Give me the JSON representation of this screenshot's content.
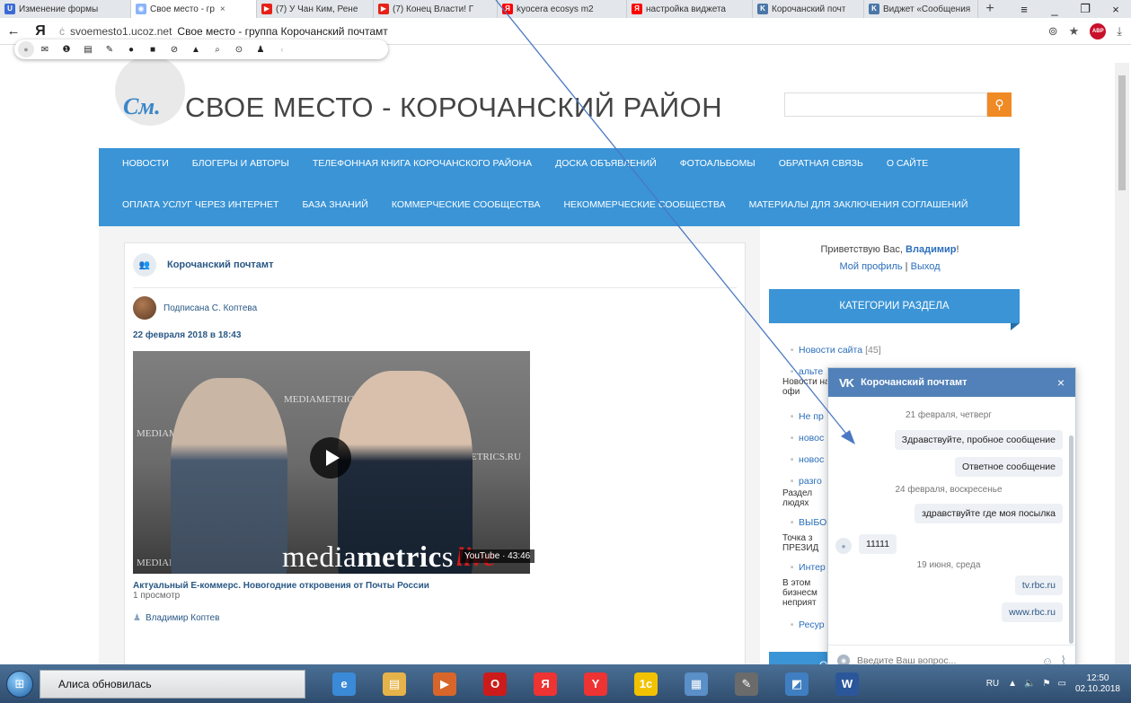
{
  "browser": {
    "tabs": [
      {
        "label": "Изменение формы",
        "icon": "ucoz-icon",
        "color": "#3b6cd6",
        "glyph": "U",
        "active": false
      },
      {
        "label": "Свое место - гр",
        "icon": "site-icon",
        "color": "#8ab4f8",
        "glyph": "◉",
        "active": true
      },
      {
        "label": "(7) У Чан Ким, Рене",
        "icon": "youtube-icon",
        "color": "#e62117",
        "glyph": "▶",
        "active": false
      },
      {
        "label": "(7) Конец Власти! Г",
        "icon": "youtube-icon",
        "color": "#e62117",
        "glyph": "▶",
        "active": false
      },
      {
        "label": "kyocera ecosys m2",
        "icon": "yandex-icon",
        "color": "#ff0000",
        "glyph": "Я",
        "active": false
      },
      {
        "label": "настройка виджета",
        "icon": "yandex-icon",
        "color": "#ff0000",
        "glyph": "Я",
        "active": false
      },
      {
        "label": "Корочанский почт",
        "icon": "vk-icon",
        "color": "#4a76a8",
        "glyph": "K",
        "active": false
      },
      {
        "label": "Виджет «Сообщения",
        "icon": "vk-icon",
        "color": "#4a76a8",
        "glyph": "K",
        "active": false
      }
    ],
    "active_tab_close": "×",
    "new_tab": "+",
    "window": {
      "menu": "≡",
      "minimize": "_",
      "restore": "❐",
      "close": "×"
    },
    "back": "←",
    "yandex_logo": "Я",
    "url_icon": "ċ",
    "url_domain": "svoemesto1.ucoz.net",
    "url_title": "Свое место - группа Корочанский почтамт",
    "ext_icon": "⊚",
    "bookmark": "★",
    "adblock": "ABP",
    "download": "⤓"
  },
  "floatbar": {
    "glyphs": [
      "✉",
      "❶",
      "▤",
      "✎",
      "●",
      "■",
      "⊘",
      "▲",
      "⌕",
      "⊙",
      "♟"
    ],
    "chevron": "‹"
  },
  "site": {
    "logo": "См.",
    "title": "СВОЕ МЕСТО - КОРОЧАНСКИЙ РАЙОН",
    "search_icon": "⚲",
    "nav_row1": [
      "Новости",
      "Блогеры и авторы",
      "Телефонная книга Корочанского района",
      "Доска объявлений",
      "Фотоальбомы",
      "Обратная связь",
      "О сайте"
    ],
    "nav_row2": [
      "Оплата услуг через интернет",
      "База знаний",
      "Коммерческие сообщества",
      "Некоммерческие сообщества",
      "Материалы для заключения соглашений"
    ]
  },
  "post": {
    "group_icon": "👥",
    "group_name": "Корочанский почтамт",
    "signed_by": "Подписана С. Коптева",
    "date": "22 февраля 2018 в 18:43",
    "video": {
      "wall_texts": [
        "MEDIAMETRICS.RU",
        "MEDIAMETRICS.RU",
        "ETRICS.RU",
        "MEDIAMETRI"
      ],
      "brand_a": "media",
      "brand_b": "metric",
      "brand_c": "s",
      "live": "live",
      "duration": "YouTube · 43:46"
    },
    "video_title": "Актуальный Е-коммерс. Новогодние откровения от Почты России",
    "views": "1 просмотр",
    "author": "Владимир Коптев"
  },
  "sidebar": {
    "greeting_prefix": "Приветствую Вас, ",
    "user": "Владимир",
    "greeting_suffix": "!",
    "profile_link": "Мой профиль",
    "link_sep": " | ",
    "logout_link": "Выход",
    "categories_title": "Категории раздела",
    "categories": [
      {
        "label": "Новости сайта",
        "count": "[45]"
      },
      {
        "label": "альте",
        "count": ""
      },
      {
        "label": "Не пр",
        "count": ""
      },
      {
        "label": "новос",
        "count": ""
      },
      {
        "label": "новос",
        "count": ""
      },
      {
        "label": "разго",
        "count": ""
      },
      {
        "label": "ВЫБО",
        "count": ""
      },
      {
        "label": "Интер",
        "count": ""
      },
      {
        "label": "Ресур",
        "count": ""
      }
    ],
    "descriptions": [
      "Новости на офи",
      "Раздел людях",
      "Точка з ПРЕЗИД",
      "В этом бизнесм неприят"
    ],
    "bottom_letter": "О"
  },
  "vk_widget": {
    "title": "Корочанский почтамт",
    "logo": "VK",
    "close": "×",
    "messages": [
      {
        "type": "day",
        "text": "21 февраля, четверг"
      },
      {
        "type": "out",
        "text": "Здравствуйте, пробное сообщение"
      },
      {
        "type": "out",
        "text": "Ответное сообщение"
      },
      {
        "type": "day",
        "text": "24 февраля, воскресенье"
      },
      {
        "type": "out",
        "text": "здравствуйте где моя посылка"
      },
      {
        "type": "in",
        "text": "11111"
      },
      {
        "type": "day",
        "text": "19 июня, среда"
      },
      {
        "type": "out-link",
        "text": "tv.rbc.ru"
      },
      {
        "type": "out-link",
        "text": "www.rbc.ru"
      }
    ],
    "input_placeholder": "Введите Ваш вопрос...",
    "emoji_icon": "☺",
    "attach_icon": "⌇"
  },
  "taskbar": {
    "start": "⊞",
    "notification": "Алиса обновилась",
    "apps": [
      {
        "name": "ie-icon",
        "glyph": "e",
        "color": "#3b8ad8"
      },
      {
        "name": "explorer-icon",
        "glyph": "▤",
        "color": "#e6b34a"
      },
      {
        "name": "media-icon",
        "glyph": "▶",
        "color": "#d8662a"
      },
      {
        "name": "opera-icon",
        "glyph": "O",
        "color": "#cc1b1b"
      },
      {
        "name": "yandex-browser-icon",
        "glyph": "Я",
        "color": "#e33"
      },
      {
        "name": "yandex-icon",
        "glyph": "Y",
        "color": "#e33"
      },
      {
        "name": "1c-icon",
        "glyph": "1c",
        "color": "#f2c200"
      },
      {
        "name": "calculator-icon",
        "glyph": "▦",
        "color": "#5a8fc7"
      },
      {
        "name": "paint-icon",
        "glyph": "✎",
        "color": "#6b6b6b"
      },
      {
        "name": "notebook-icon",
        "glyph": "◩",
        "color": "#3f7fc1"
      },
      {
        "name": "word-icon",
        "glyph": "W",
        "color": "#2b579a"
      }
    ],
    "lang": "RU",
    "tray_glyphs": [
      "▲",
      "🔈",
      "⚑",
      "▭"
    ],
    "time": "12:50",
    "date": "02.10.2018"
  },
  "colors": {
    "accent": "#3a94d6",
    "search_button": "#f08a24",
    "vk": "#5181b8",
    "link": "#2a5885",
    "annotation_arrow": "#4a78c2"
  }
}
